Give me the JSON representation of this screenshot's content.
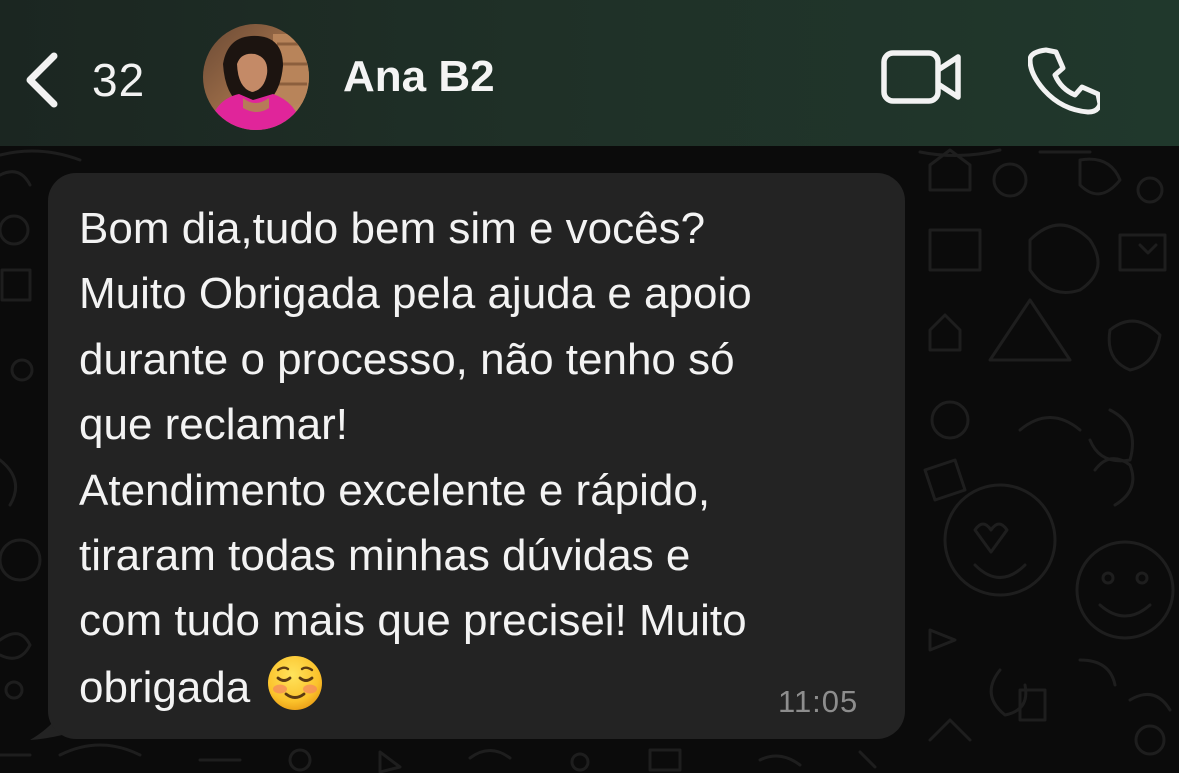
{
  "header": {
    "back_icon": "chevron-left-icon",
    "unread_count": "32",
    "contact_name": "Ana B2",
    "video_icon": "video-camera-icon",
    "call_icon": "phone-icon"
  },
  "message": {
    "lines": [
      "Bom dia,tudo bem sim e vocês?",
      "Muito Obrigada pela ajuda e apoio",
      "durante o processo, não tenho só",
      "que reclamar!",
      "Atendimento excelente e rápido,",
      "tiraram todas minhas dúvidas e",
      "com tudo mais que precisei! Muito",
      "obrigada"
    ],
    "emoji": "smiling-face-icon",
    "time": "11:05"
  },
  "colors": {
    "header_gradient_start": "#1b2621",
    "header_gradient_end": "#20382c",
    "bubble": "#232323",
    "background": "#0b0b0b",
    "timestamp": "#8d8d8d",
    "text": "#f3f3f3"
  }
}
